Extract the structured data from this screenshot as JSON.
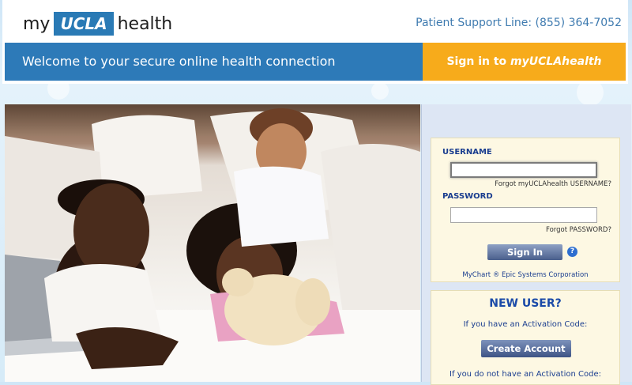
{
  "header": {
    "logo": {
      "my": "my",
      "ucla": "UCLA",
      "health": "health"
    },
    "support_line": "Patient Support Line: (855) 364-7052",
    "welcome": "Welcome to your secure online health connection",
    "signin_prefix": "Sign in to ",
    "signin_brand": "myUCLAhealth"
  },
  "login": {
    "username_label": "USERNAME",
    "username_value": "",
    "forgot_username": "Forgot myUCLAhealth USERNAME?",
    "password_label": "PASSWORD",
    "password_value": "",
    "forgot_password": "Forgot PASSWORD?",
    "signin_button": "Sign In",
    "help_icon": "?",
    "copyright": "MyChart ® Epic Systems Corporation"
  },
  "new_user": {
    "title": "NEW USER?",
    "has_code": "If you have an Activation Code:",
    "create_account_button": "Create Account",
    "no_code": "If you do not have an Activation Code:"
  },
  "colors": {
    "blue_banner": "#2d7ab8",
    "orange_banner": "#f7ab1b",
    "link_blue": "#1a3d8f"
  }
}
